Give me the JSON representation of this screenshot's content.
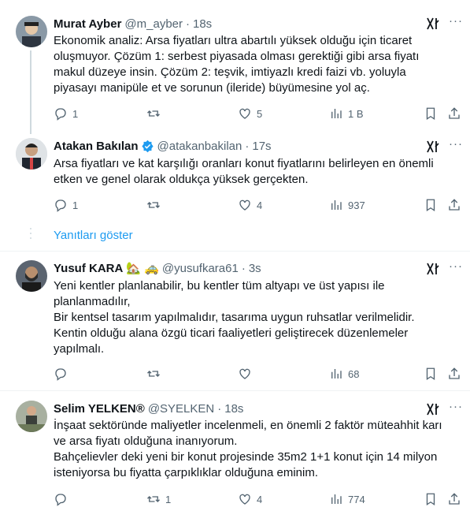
{
  "tweets": [
    {
      "name": "Murat Ayber",
      "handle": "@m_ayber",
      "time": "18s",
      "text": "Ekonomik analiz: Arsa fiyatları ultra abartılı yüksek olduğu için ticaret oluşmuyor. Çözüm 1: serbest piyasada olması gerektiği gibi arsa fiyatı makul düzeye insin. Çözüm 2: teşvik, imtiyazlı kredi faizi vb. yoluyla piyasayı manipüle et ve sorunun (ileride) büyümesine yol aç.",
      "replies": "1",
      "retweets": "",
      "likes": "5",
      "views": "1 B"
    },
    {
      "name": "Atakan Bakılan",
      "handle": "@atakanbakilan",
      "time": "17s",
      "text": "Arsa fiyatları ve kat karşılığı oranları konut fiyatlarını belirleyen en önemli etken ve genel olarak oldukça yüksek gerçekten.",
      "replies": "1",
      "retweets": "",
      "likes": "4",
      "views": "937"
    },
    {
      "name": "Yusuf KARA",
      "name_emoji": "🏡 🚕",
      "handle": "@yusufkara61",
      "time": "3s",
      "text": "Yeni kentler planlanabilir, bu kentler tüm altyapı ve üst yapısı ile planlanmadılır,\nBir kentsel tasarım yapılmalıdır, tasarıma uygun ruhsatlar verilmelidir.\nKentin olduğu alana özgü ticari faaliyetleri geliştirecek düzenlemeler yapılmalı.",
      "replies": "",
      "retweets": "",
      "likes": "",
      "views": "68"
    },
    {
      "name": "Selim YELKEN®",
      "handle": "@SYELKEN",
      "time": "18s",
      "text": "İnşaat sektöründe maliyetler incelenmeli, en önemli 2 faktör müteahhit karı ve arsa fiyatı olduğuna inanıyorum.\nBahçelievler deki yeni bir konut projesinde 35m2 1+1 konut için 14 milyon isteniyorsa bu fiyatta çarpıklıklar olduğuna eminim.",
      "replies": "",
      "retweets": "1",
      "likes": "4",
      "views": "774"
    }
  ],
  "show_replies": "Yanıtları göster",
  "colors": {
    "accent": "#1d9bf0",
    "muted": "#536471",
    "text": "#0f1419",
    "verified": "#1d9bf0"
  },
  "icons": [
    "reply-icon",
    "retweet-icon",
    "like-icon",
    "views-icon",
    "bookmark-icon",
    "share-icon",
    "grok-icon",
    "more-icon",
    "verified-icon"
  ]
}
